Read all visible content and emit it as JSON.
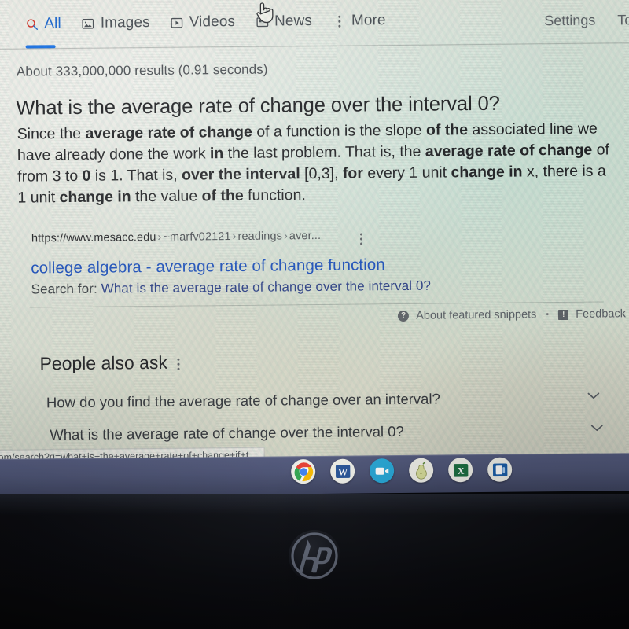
{
  "nav": {
    "tabs": [
      {
        "label": "All",
        "icon": "search-icon",
        "active": true
      },
      {
        "label": "Images",
        "icon": "image-icon",
        "active": false
      },
      {
        "label": "Videos",
        "icon": "video-icon",
        "active": false
      },
      {
        "label": "News",
        "icon": "news-icon",
        "active": false
      },
      {
        "label": "More",
        "icon": "kebab-icon",
        "active": false
      }
    ],
    "settings_label": "Settings",
    "tools_label": "Tool"
  },
  "results": {
    "stats": "About 333,000,000 results (0.91 seconds)"
  },
  "featured_snippet": {
    "title": "What is the average rate of change over the interval 0?",
    "body_html": "Since the <b>average rate of change</b> of a function is the slope <b>of the</b> associated line we have already done the work <b>in</b> the last problem. That is, the <b>average rate of change</b> of from 3 to <b>0</b> is 1. That is, <b>over the interval</b> [0,3], <b>for</b> every 1 unit <b>change in</b> x, there is a 1 unit <b>change in</b> the value <b>of the</b> function.",
    "source_host": "https://www.mesacc.edu",
    "source_crumbs": [
      "~marfv02121",
      "readings",
      "aver..."
    ],
    "source_title": "college algebra - average rate of change function",
    "source_sub_lead": "Search for:",
    "source_sub_query": "What is the average rate of change over the interval 0?",
    "about_label": "About featured snippets",
    "separator": "•",
    "feedback_label": "Feedback",
    "help_glyph": "?",
    "feedback_glyph": "!"
  },
  "people_also_ask": {
    "heading": "People also ask",
    "questions": [
      "How do you find the average rate of change over an interval?",
      "What is the average rate of change over the interval 0?"
    ]
  },
  "status_bar": {
    "url": "om/search?q=what+is+the+average+rate+of+change+if+t..."
  },
  "taskbar": {
    "icons": [
      {
        "name": "chrome-icon",
        "label": "Google Chrome",
        "active": true
      },
      {
        "name": "word-icon",
        "label": "Microsoft Word",
        "active": false
      },
      {
        "name": "video-call-icon",
        "label": "Zoom",
        "active": false
      },
      {
        "name": "pear-icon",
        "label": "Pear Deck",
        "active": false
      },
      {
        "name": "excel-icon",
        "label": "Microsoft Excel",
        "active": false
      },
      {
        "name": "office-icon",
        "label": "Microsoft Office",
        "active": false
      }
    ]
  },
  "device": {
    "brand_logo": "hp-logo"
  },
  "colors": {
    "accent_blue": "#1a73e8",
    "link_blue": "#1a4fbd",
    "text": "#202124",
    "muted": "#5f6368",
    "taskbar": "#4e5576",
    "bezel": "#0b0c10"
  }
}
